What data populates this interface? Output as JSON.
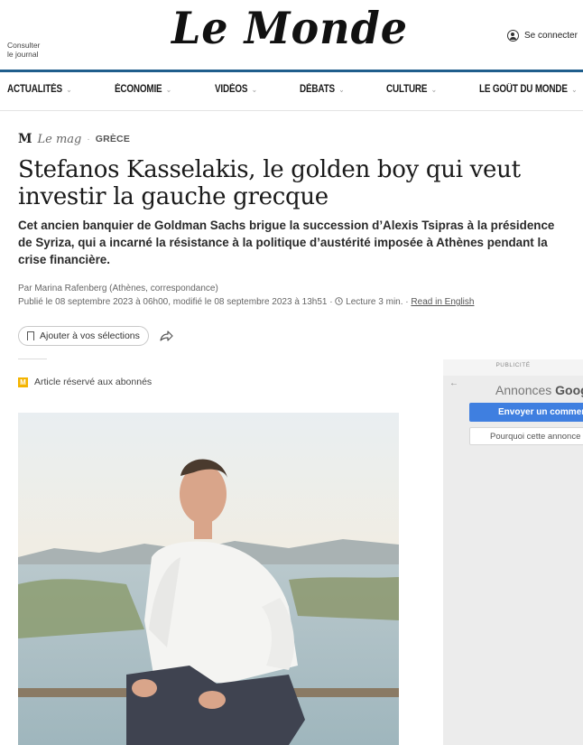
{
  "header": {
    "consult_line1": "Consulter",
    "consult_line2": "le journal",
    "logo": "Le Monde",
    "login": "Se connecter"
  },
  "nav": {
    "items": [
      {
        "label": "ACTUALITÉS"
      },
      {
        "label": "ÉCONOMIE"
      },
      {
        "label": "VIDÉOS"
      },
      {
        "label": "DÉBATS"
      },
      {
        "label": "CULTURE"
      },
      {
        "label": "LE GOÛT DU MONDE"
      }
    ],
    "chevron": "⌄"
  },
  "article": {
    "mag_logo": "M",
    "mag_sub": "Le mag",
    "kicker_dot": "·",
    "category": "GRÈCE",
    "title": "Stefanos Kasselakis, le golden boy qui veut investir la gauche grecque",
    "lead": "Cet ancien banquier de Goldman Sachs brigue la succession d’Alexis Tsipras à la présidence de Syriza, qui a incarné la résistance à la politique d’austérité imposée à Athènes pendant la crise financière.",
    "author": "Par Marina Rafenberg (Athènes, correspondance)",
    "published": "Publié le 08 septembre 2023 à 06h00, modifié le 08 septembre 2023 à 13h51",
    "reading_time": "Lecture 3 min.",
    "read_in_english": "Read in English",
    "save_label": "Ajouter à vos sélections",
    "premium_label": "Article réservé aux abonnés",
    "premium_badge": "M"
  },
  "ad": {
    "label": "PUBLICITÉ",
    "back": "←",
    "title_prefix": "Annonces ",
    "title_brand": "Google",
    "feedback_button": "Envoyer un commentaire",
    "why_button": "Pourquoi cette annonce ?"
  },
  "colors": {
    "rule_blue": "#1f5e8c",
    "premium_yellow": "#f4b400",
    "ad_button_blue": "#3f7fe0"
  }
}
